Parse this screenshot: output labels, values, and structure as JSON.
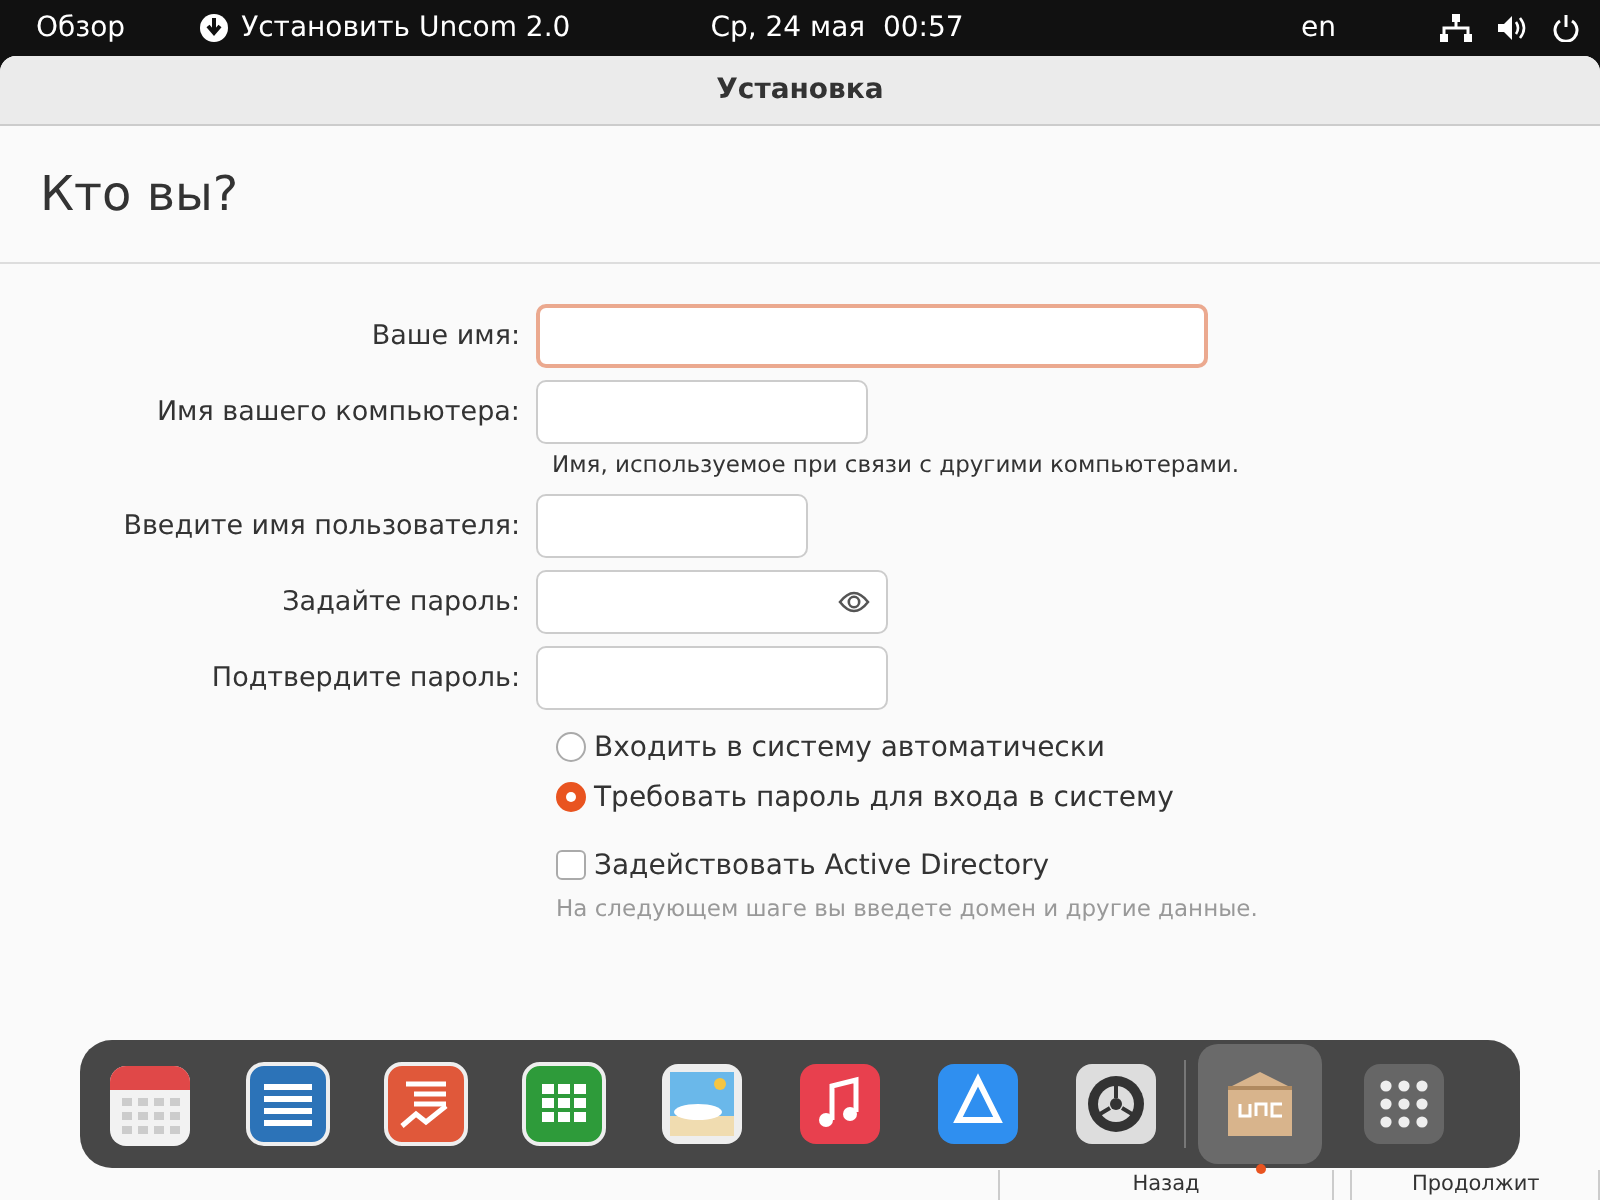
{
  "top_bar": {
    "activities": "Обзор",
    "app_menu": "Установить Uncom 2.0",
    "clock": "Ср, 24 мая  00:57",
    "keyboard_layout": "en"
  },
  "window": {
    "title": "Установка"
  },
  "page": {
    "heading": "Кто вы?"
  },
  "fields": [
    {
      "label": "Ваше имя:",
      "focused": true,
      "reveal": false
    },
    {
      "label": "Имя вашего компьютера:",
      "focused": false,
      "hint": "Имя, используемое при связи с другими компьютерами.",
      "reveal": false
    },
    {
      "label": "Введите имя пользователя:",
      "focused": false,
      "reveal": false
    },
    {
      "label": "Задайте пароль:",
      "focused": false,
      "reveal": true
    },
    {
      "label": "Подтвердите пароль:",
      "focused": false,
      "reveal": false
    }
  ],
  "login_options": [
    {
      "label": "Входить в систему автоматически",
      "selected": false
    },
    {
      "label": "Требовать пароль для входа в систему",
      "selected": true
    }
  ],
  "active_directory": {
    "label": "Задействовать Active Directory",
    "checked": false,
    "note": "На следующем шаге вы введете домен и другие данные."
  },
  "buttons": [
    {
      "label": "Назад"
    },
    {
      "label": "Продолжит"
    }
  ],
  "dock": {
    "items": [
      {
        "kind": "calendar",
        "running": false
      },
      {
        "kind": "writer",
        "running": false
      },
      {
        "kind": "impress",
        "running": false
      },
      {
        "kind": "calc",
        "running": false
      },
      {
        "kind": "photos",
        "running": false
      },
      {
        "kind": "music",
        "running": false
      },
      {
        "kind": "appstore",
        "running": false
      },
      {
        "kind": "settings",
        "running": false
      },
      {
        "kind": "installer",
        "running": true
      },
      {
        "kind": "apps",
        "running": false
      }
    ]
  }
}
